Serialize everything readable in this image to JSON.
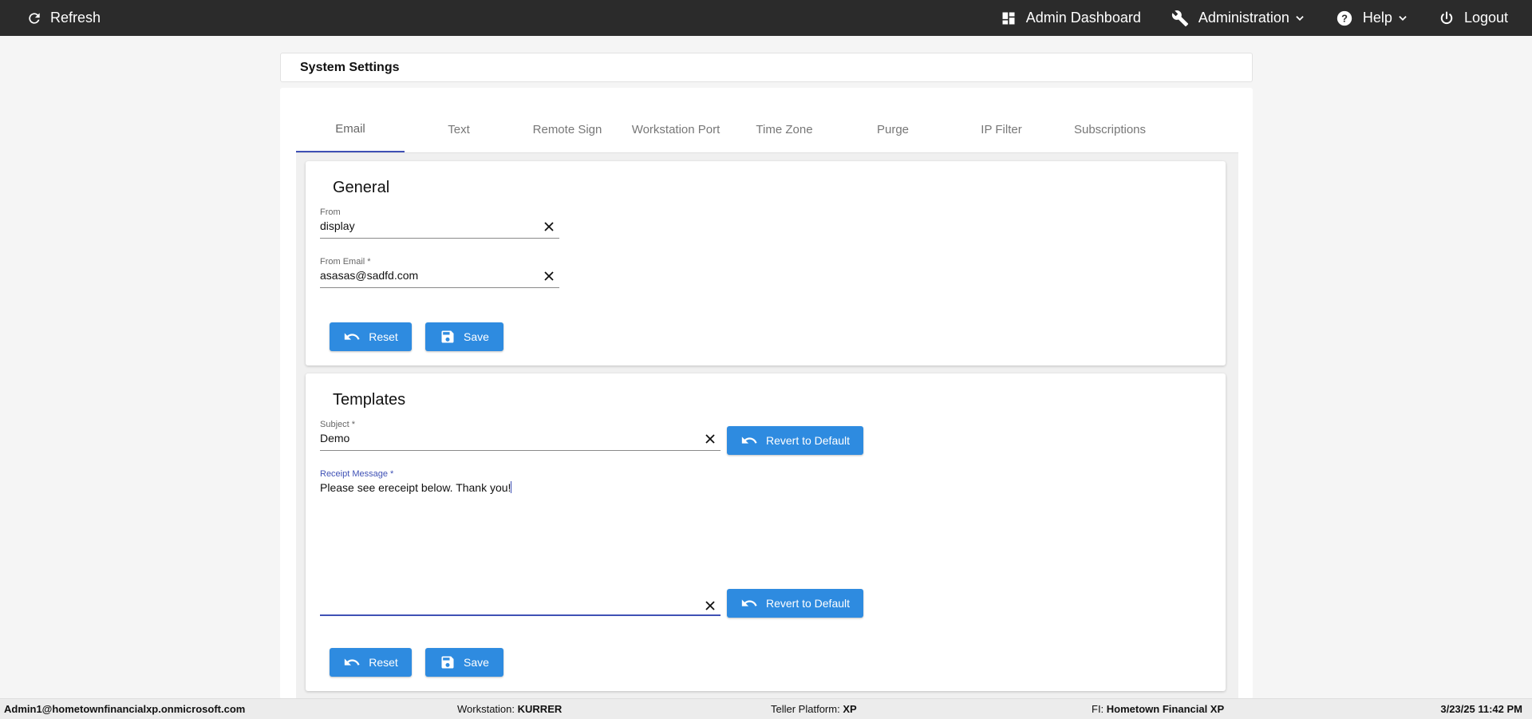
{
  "topbar": {
    "refresh_label": "Refresh",
    "admin_dashboard_label": "Admin Dashboard",
    "administration_label": "Administration",
    "help_label": "Help",
    "logout_label": "Logout",
    "background": "#2b2b2b"
  },
  "page_title": "System Settings",
  "tabs": [
    {
      "label": "Email",
      "active": true
    },
    {
      "label": "Text"
    },
    {
      "label": "Remote Sign"
    },
    {
      "label": "Workstation Port"
    },
    {
      "label": "Time Zone"
    },
    {
      "label": "Purge"
    },
    {
      "label": "IP Filter"
    },
    {
      "label": "Subscriptions"
    }
  ],
  "general": {
    "title": "General",
    "from": {
      "label": "From",
      "value": "display"
    },
    "from_email": {
      "label": "From Email *",
      "value": "asasas@sadfd.com"
    },
    "reset_label": "Reset",
    "save_label": "Save"
  },
  "templates": {
    "title": "Templates",
    "subject": {
      "label": "Subject *",
      "value": "Demo"
    },
    "receipt_message": {
      "label": "Receipt Message *",
      "value": "Please see ereceipt below. Thank you!"
    },
    "revert_label": "Revert to Default",
    "reset_label": "Reset",
    "save_label": "Save"
  },
  "statusbar": {
    "user": "Admin1@hometownfinancialxp.onmicrosoft.com",
    "workstation_label": "Workstation:",
    "workstation_value": "KURRER",
    "platform_label": "Teller Platform:",
    "platform_value": "XP",
    "fi_label": "FI:",
    "fi_value": "Hometown Financial XP",
    "datetime": "3/23/25 11:42 PM"
  },
  "colors": {
    "accent_button": "#2e8be0",
    "tab_indicator": "#3f51b5"
  },
  "icons": {
    "refresh": "refresh-icon",
    "dashboard": "dashboard-icon",
    "administration": "wrench-icon",
    "help": "help-circle-icon",
    "logout": "power-icon",
    "clear": "close-icon",
    "reset": "undo-icon",
    "save": "floppy-icon"
  }
}
